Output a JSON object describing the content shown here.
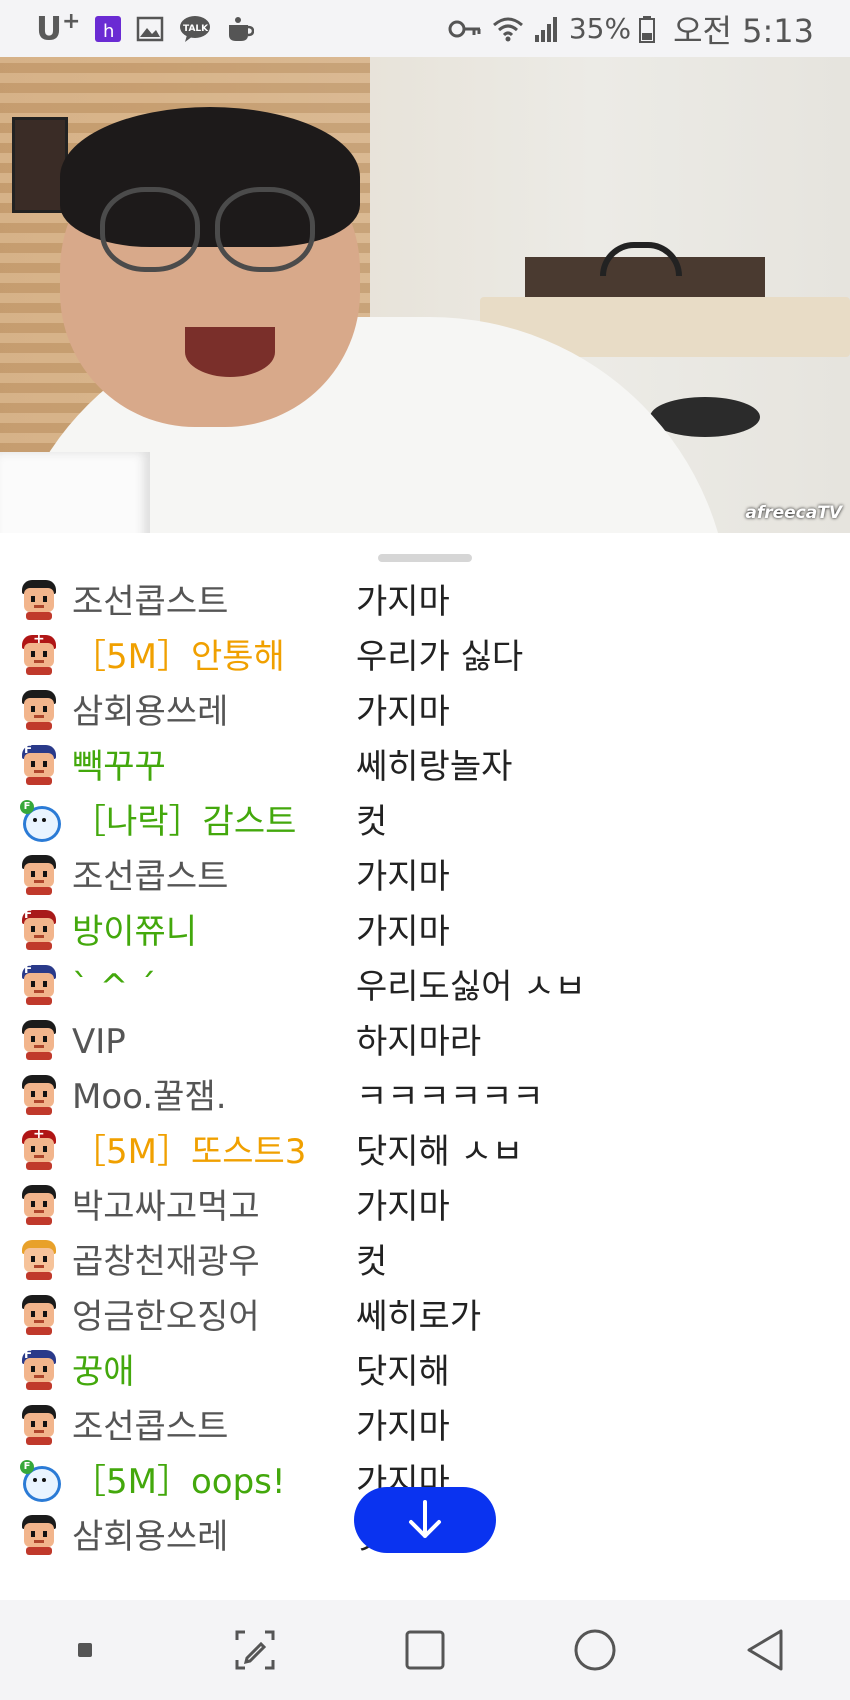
{
  "status_bar": {
    "carrier": "U",
    "carrier_plus": "+",
    "battery": "35%",
    "time": "오전 5:13",
    "icons": [
      "h-icon",
      "image-icon",
      "talk-icon",
      "cup-icon",
      "key-icon",
      "wifi-icon",
      "signal-icon",
      "battery-icon"
    ]
  },
  "video": {
    "watermark": "afreecaTV"
  },
  "chat": {
    "rows": [
      {
        "nick": "조선콥스트",
        "msg": "가지마",
        "nick_color": "gray",
        "avatar": "boy"
      },
      {
        "nick": "［5M］안통해",
        "msg": "우리가 싫다",
        "nick_color": "orange",
        "avatar": "cap"
      },
      {
        "nick": "삼회용쓰레",
        "msg": "가지마",
        "nick_color": "gray",
        "avatar": "boy"
      },
      {
        "nick": "빽꾸꾸",
        "msg": "쎄히랑놀자",
        "nick_color": "green",
        "avatar": "fan"
      },
      {
        "nick": "［나락］감스트",
        "msg": "컷",
        "nick_color": "green",
        "avatar": "bear"
      },
      {
        "nick": "조선콥스트",
        "msg": "가지마",
        "nick_color": "gray",
        "avatar": "boy"
      },
      {
        "nick": "방이쮸니",
        "msg": "가지마",
        "nick_color": "green",
        "avatar": "fanred"
      },
      {
        "nick": "` ^ ´",
        "msg": "우리도싫어 ㅅㅂ",
        "nick_color": "green",
        "avatar": "fan"
      },
      {
        "nick": "VIP",
        "msg": "하지마라",
        "nick_color": "gray",
        "avatar": "boy"
      },
      {
        "nick": "Moo.꿀잼.",
        "msg": "ㅋㅋㅋㅋㅋㅋ",
        "nick_color": "gray",
        "avatar": "boy"
      },
      {
        "nick": "［5M］또스트3",
        "msg": "닷지해 ㅅㅂ",
        "nick_color": "orange",
        "avatar": "cap"
      },
      {
        "nick": "박고싸고먹고",
        "msg": "가지마",
        "nick_color": "gray",
        "avatar": "boy"
      },
      {
        "nick": "곱창천재광우",
        "msg": "컷",
        "nick_color": "gray",
        "avatar": "blond"
      },
      {
        "nick": "엉금한오징어",
        "msg": "쎄히로가",
        "nick_color": "gray",
        "avatar": "boy"
      },
      {
        "nick": "꿍애",
        "msg": "닷지해",
        "nick_color": "green",
        "avatar": "fan"
      },
      {
        "nick": "조선콥스트",
        "msg": "가지마",
        "nick_color": "gray",
        "avatar": "boy"
      },
      {
        "nick": "［5M］oops!",
        "msg": "가지마",
        "nick_color": "green",
        "avatar": "bear"
      },
      {
        "nick": "삼회용쓰레",
        "msg": "닷지해",
        "nick_color": "gray",
        "avatar": "boy"
      }
    ]
  },
  "colors": {
    "accent_blue": "#0a33f0",
    "nick_orange": "#f0a000",
    "nick_green": "#43a80c",
    "nick_gray": "#555555"
  }
}
